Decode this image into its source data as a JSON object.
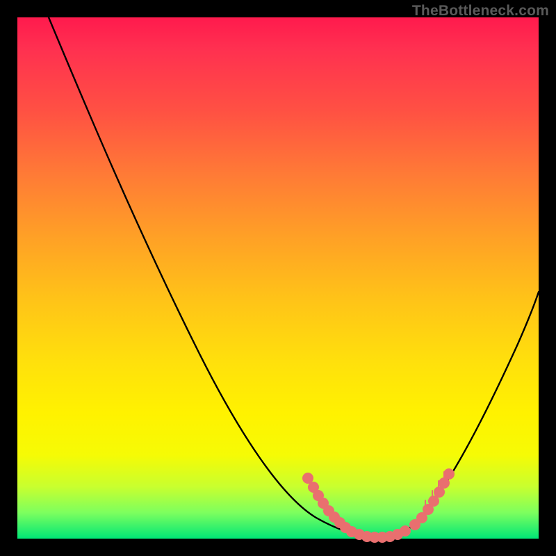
{
  "watermark": "TheBottleneck.com",
  "chart_data": {
    "type": "line",
    "title": "",
    "xlabel": "",
    "ylabel": "",
    "xlim": [
      0,
      100
    ],
    "ylim": [
      0,
      100
    ],
    "grid": false,
    "series": [
      {
        "name": "bottleneck-curve",
        "x": [
          6,
          10,
          15,
          20,
          25,
          30,
          35,
          40,
          45,
          50,
          55,
          57,
          60,
          62,
          65,
          70,
          75,
          80,
          85,
          90,
          95,
          100
        ],
        "values": [
          100,
          92,
          83,
          74,
          65,
          56,
          47,
          38,
          29,
          20,
          12,
          9,
          5,
          3,
          1,
          0,
          3,
          9,
          17,
          27,
          38,
          49
        ]
      }
    ],
    "markers": [
      {
        "name": "left-cluster",
        "x_range": [
          55,
          63
        ],
        "y_range": [
          1,
          12
        ],
        "color": "#e96f6f",
        "count": 10
      },
      {
        "name": "right-cluster",
        "x_range": [
          76,
          84
        ],
        "y_range": [
          3,
          15
        ],
        "color": "#e96f6f",
        "count": 9
      },
      {
        "name": "bottom-cluster",
        "x_range": [
          63,
          76
        ],
        "y_range": [
          0,
          3
        ],
        "color": "#e96f6f",
        "count": 8
      }
    ],
    "colors": {
      "curve": "#000000",
      "marker": "#e96f6f",
      "gradient_top": "#ff1a4d",
      "gradient_mid": "#ffe00c",
      "gradient_bottom": "#00e676",
      "frame": "#000000"
    }
  }
}
